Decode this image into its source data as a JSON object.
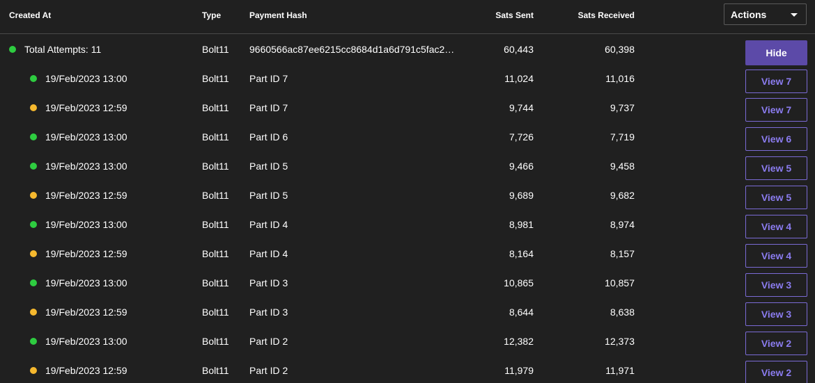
{
  "columns": {
    "created_at": "Created At",
    "type": "Type",
    "payment_hash": "Payment Hash",
    "sats_sent": "Sats Sent",
    "sats_received": "Sats Received"
  },
  "actions": {
    "label": "Actions"
  },
  "colors": {
    "success": "#2ecc40",
    "pending": "#f5b82e",
    "accent": "#7b6bd6"
  },
  "summary": {
    "created_at": "Total Attempts: 11",
    "type": "Bolt11",
    "payment_hash": "9660566ac87ee6215cc8684d1a6d791c5fac2…",
    "sats_sent": "60,443",
    "sats_received": "60,398",
    "status": "success",
    "button": "Hide"
  },
  "rows": [
    {
      "created_at": "19/Feb/2023 13:00",
      "type": "Bolt11",
      "part": "Part ID 7",
      "sats_sent": "11,024",
      "sats_received": "11,016",
      "status": "success",
      "button": "View 7"
    },
    {
      "created_at": "19/Feb/2023 12:59",
      "type": "Bolt11",
      "part": "Part ID 7",
      "sats_sent": "9,744",
      "sats_received": "9,737",
      "status": "pending",
      "button": "View 7"
    },
    {
      "created_at": "19/Feb/2023 13:00",
      "type": "Bolt11",
      "part": "Part ID 6",
      "sats_sent": "7,726",
      "sats_received": "7,719",
      "status": "success",
      "button": "View 6"
    },
    {
      "created_at": "19/Feb/2023 13:00",
      "type": "Bolt11",
      "part": "Part ID 5",
      "sats_sent": "9,466",
      "sats_received": "9,458",
      "status": "success",
      "button": "View 5"
    },
    {
      "created_at": "19/Feb/2023 12:59",
      "type": "Bolt11",
      "part": "Part ID 5",
      "sats_sent": "9,689",
      "sats_received": "9,682",
      "status": "pending",
      "button": "View 5"
    },
    {
      "created_at": "19/Feb/2023 13:00",
      "type": "Bolt11",
      "part": "Part ID 4",
      "sats_sent": "8,981",
      "sats_received": "8,974",
      "status": "success",
      "button": "View 4"
    },
    {
      "created_at": "19/Feb/2023 12:59",
      "type": "Bolt11",
      "part": "Part ID 4",
      "sats_sent": "8,164",
      "sats_received": "8,157",
      "status": "pending",
      "button": "View 4"
    },
    {
      "created_at": "19/Feb/2023 13:00",
      "type": "Bolt11",
      "part": "Part ID 3",
      "sats_sent": "10,865",
      "sats_received": "10,857",
      "status": "success",
      "button": "View 3"
    },
    {
      "created_at": "19/Feb/2023 12:59",
      "type": "Bolt11",
      "part": "Part ID 3",
      "sats_sent": "8,644",
      "sats_received": "8,638",
      "status": "pending",
      "button": "View 3"
    },
    {
      "created_at": "19/Feb/2023 13:00",
      "type": "Bolt11",
      "part": "Part ID 2",
      "sats_sent": "12,382",
      "sats_received": "12,373",
      "status": "success",
      "button": "View 2"
    },
    {
      "created_at": "19/Feb/2023 12:59",
      "type": "Bolt11",
      "part": "Part ID 2",
      "sats_sent": "11,979",
      "sats_received": "11,971",
      "status": "pending",
      "button": "View 2"
    }
  ]
}
